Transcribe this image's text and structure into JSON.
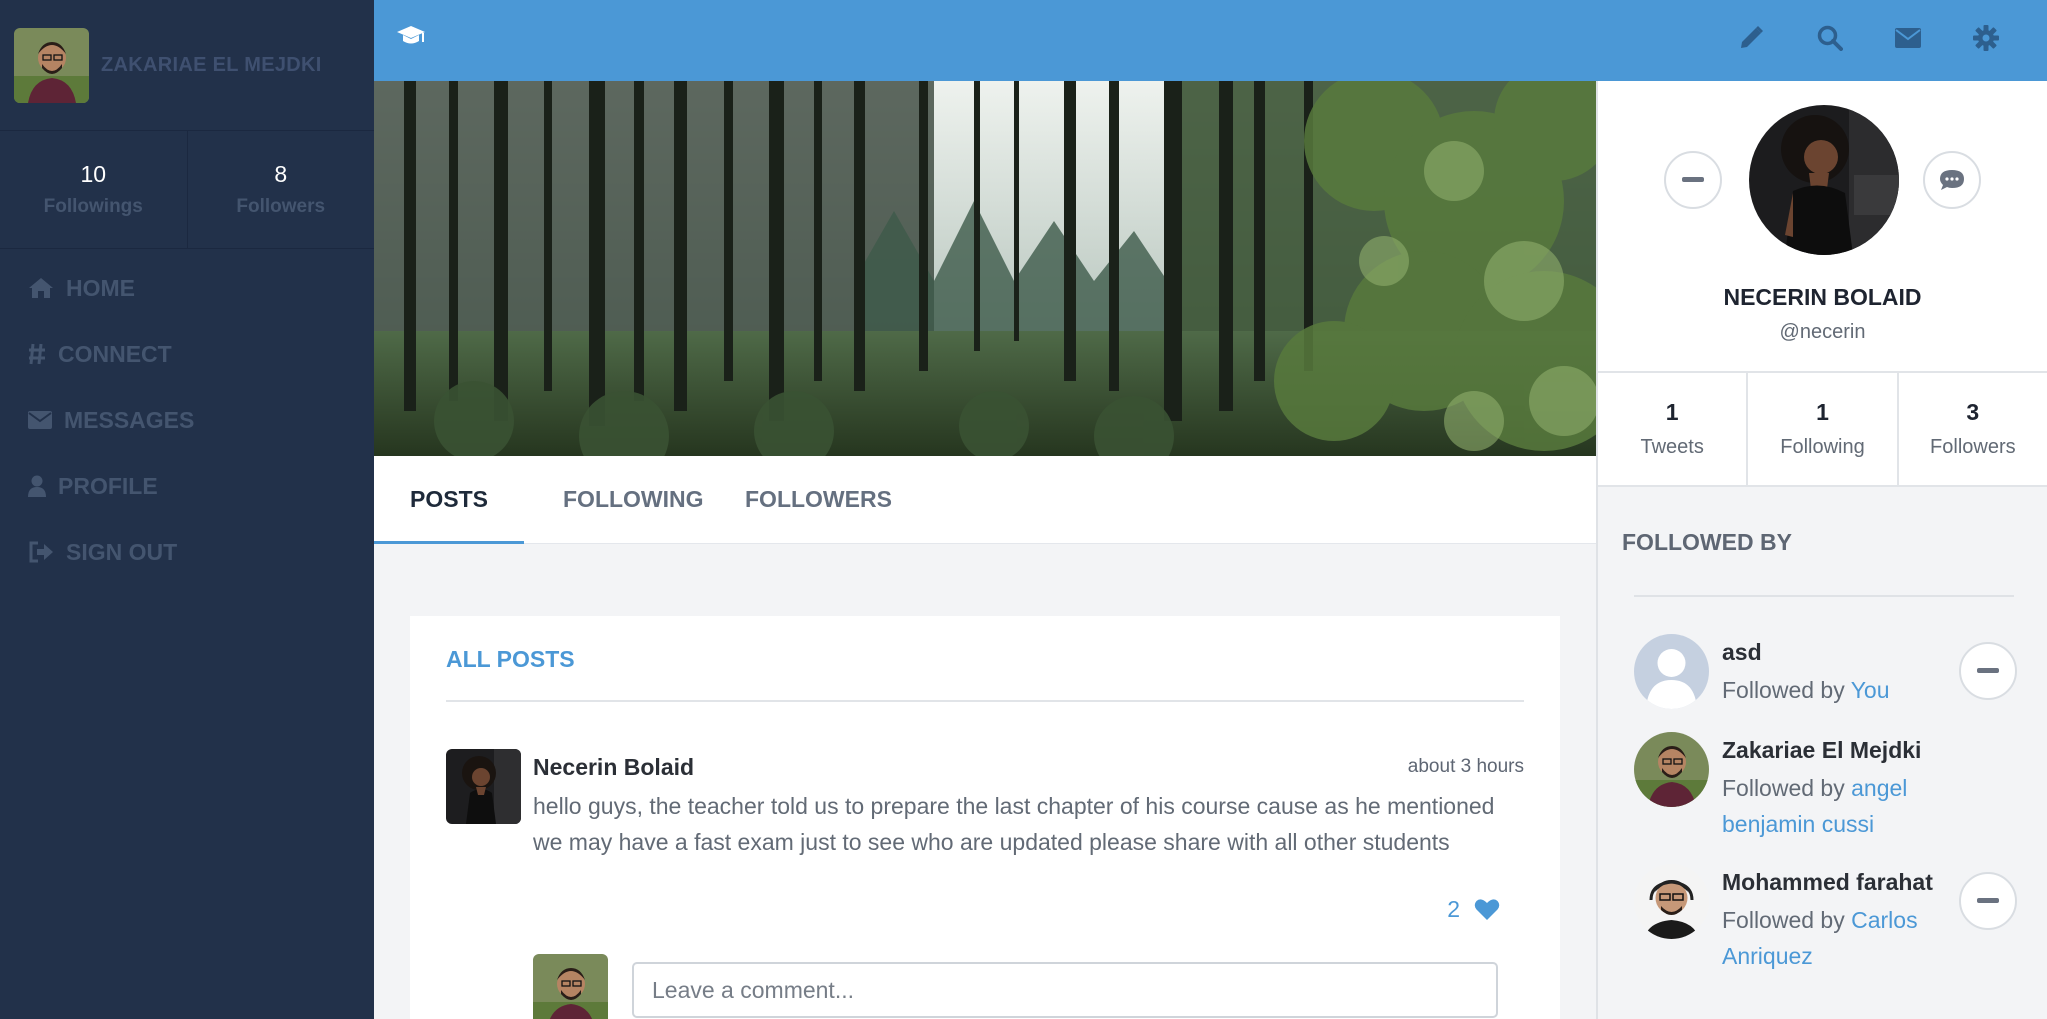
{
  "sidebar": {
    "user_name": "ZAKARIAE EL MEJDKI",
    "stats": [
      {
        "value": "10",
        "label": "Followings"
      },
      {
        "value": "8",
        "label": "Followers"
      }
    ],
    "nav": [
      {
        "icon": "home-icon",
        "label": "HOME"
      },
      {
        "icon": "hashtag-icon",
        "label": "CONNECT"
      },
      {
        "icon": "envelope-icon",
        "label": "MESSAGES"
      },
      {
        "icon": "user-icon",
        "label": "PROFILE"
      },
      {
        "icon": "sign-out-icon",
        "label": "SIGN OUT"
      }
    ]
  },
  "topbar": {
    "logo_icon": "graduation-cap-icon",
    "actions": [
      "pencil-icon",
      "search-icon",
      "envelope-icon",
      "gear-icon"
    ]
  },
  "tabs": [
    "POSTS",
    "FOLLOWING",
    "FOLLOWERS"
  ],
  "active_tab": "POSTS",
  "posts": {
    "title": "ALL POSTS",
    "items": [
      {
        "author": "Necerin Bolaid",
        "time": "about 3 hours",
        "text": "hello guys, the teacher told us to prepare the last chapter of his course cause as he mentioned we may have a fast exam just to see who are updated please share with all other students",
        "likes": "2"
      }
    ],
    "comment_placeholder": "Leave a comment..."
  },
  "profile": {
    "name": "NECERIN BOLAID",
    "handle": "@necerin",
    "stats": [
      {
        "value": "1",
        "label": "Tweets"
      },
      {
        "value": "1",
        "label": "Following"
      },
      {
        "value": "3",
        "label": "Followers"
      }
    ],
    "followed_by_title": "FOLLOWED BY",
    "followed_by": [
      {
        "name": "asd",
        "prefix": "Followed by ",
        "by": "You"
      },
      {
        "name": "Zakariae El Mejdki",
        "prefix": "Followed by ",
        "by": "angel benjamin cussi"
      },
      {
        "name": "Mohammed farahat",
        "prefix": "Followed by ",
        "by": "Carlos Anriquez"
      }
    ]
  },
  "colors": {
    "accent": "#4b98d6",
    "sidebar_bg": "#22314a",
    "sidebar_text": "#44556f"
  }
}
